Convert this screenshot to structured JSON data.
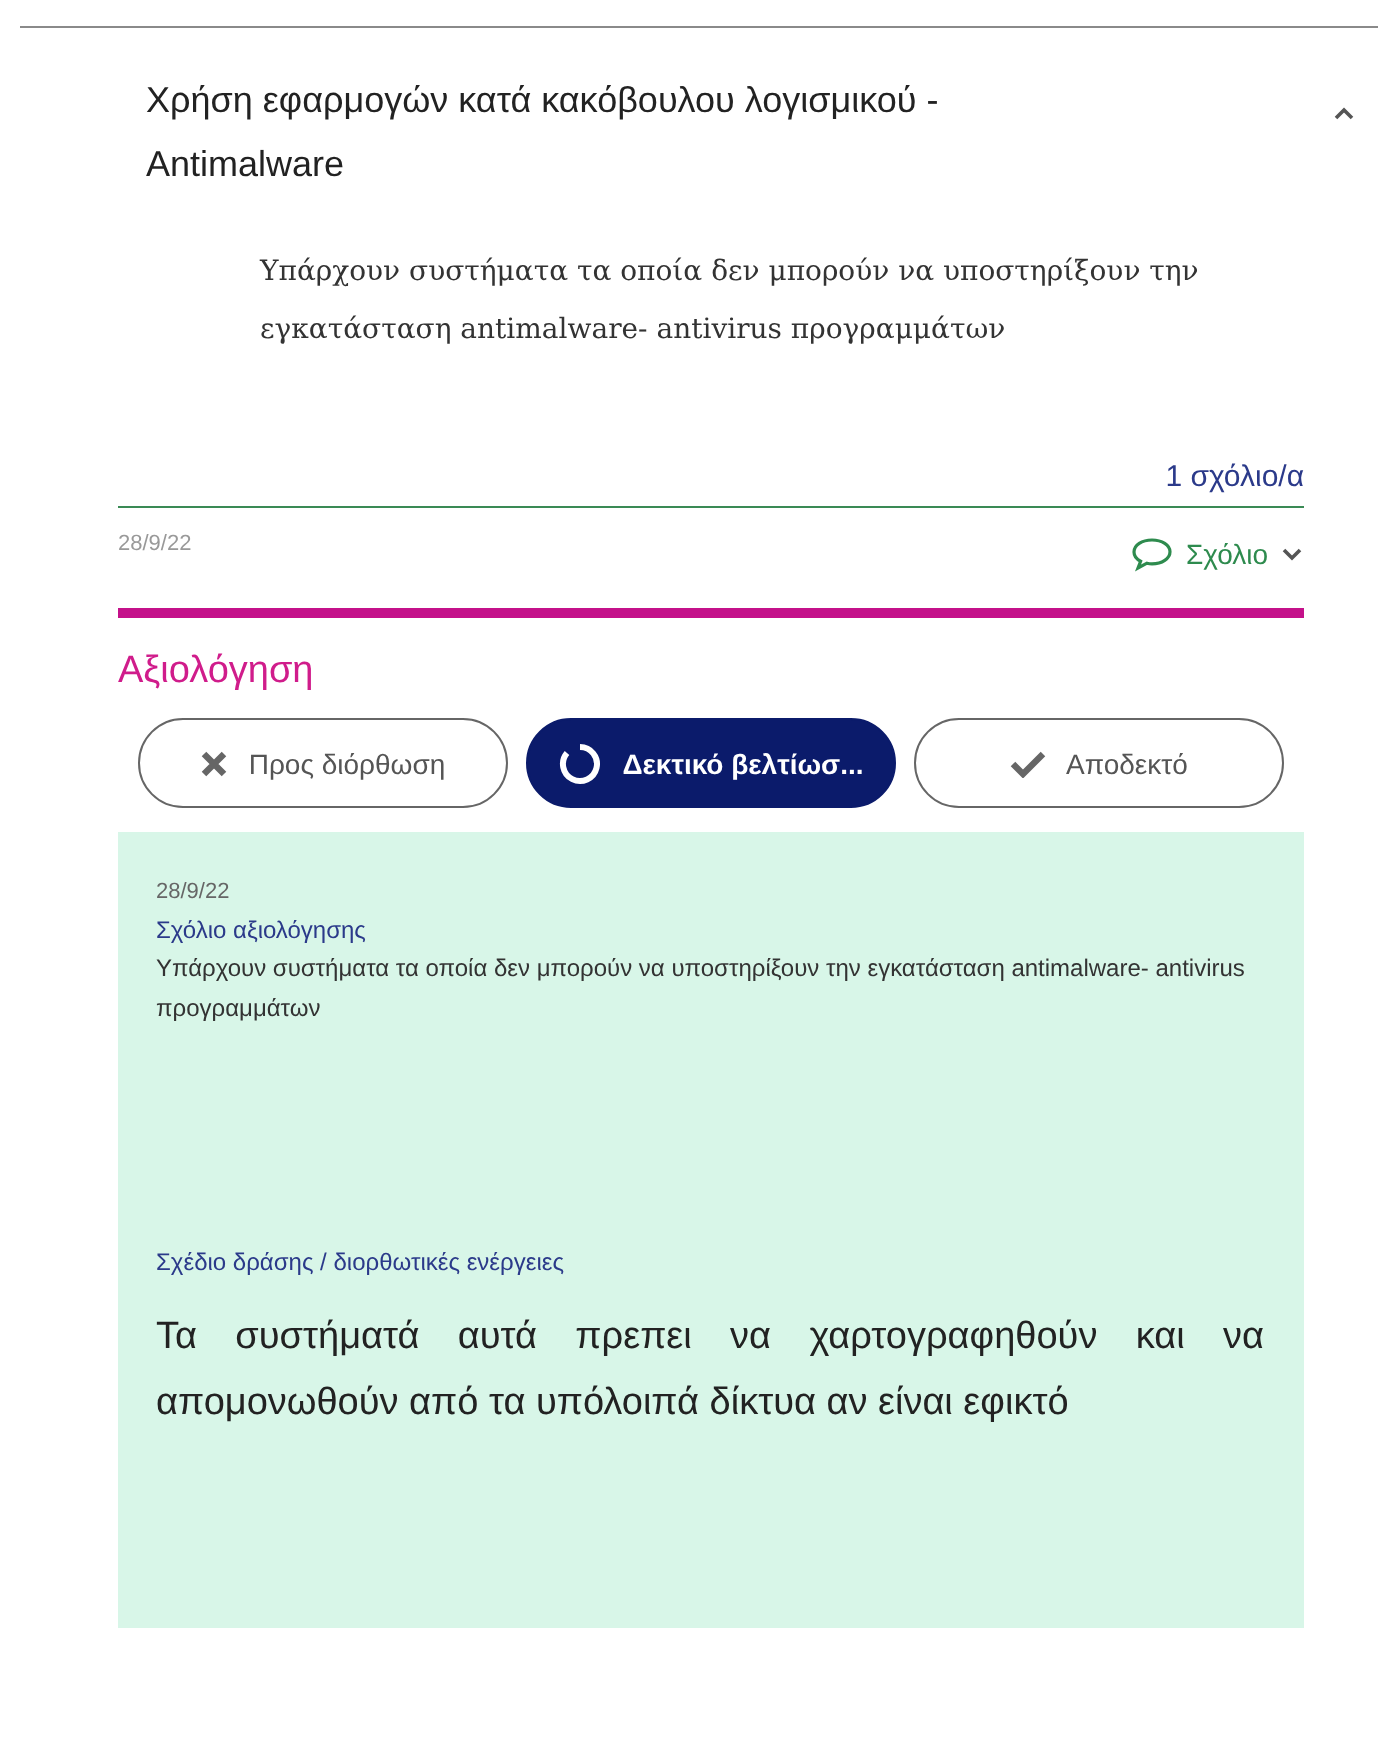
{
  "item": {
    "title": "Χρήση εφαρμογών κατά κακόβουλου λογισμικού - Antimalware",
    "expanded": true,
    "description": "Υπάρχουν συστήματα τα οποία δεν μπορούν να υποστηρίξουν την εγκατάσταση antimalware- antivirus προγραμμάτων",
    "comment_count": "1 σχόλιο/α",
    "date": "28/9/22",
    "comment_button": "Σχόλιο"
  },
  "evaluation": {
    "title": "Αξιολόγηση",
    "options": [
      {
        "kind": "cross",
        "label": "Προς διόρθωση",
        "selected": false
      },
      {
        "kind": "partial",
        "label": "Δεκτικό βελτίωσ...",
        "selected": true
      },
      {
        "kind": "check",
        "label": "Αποδεκτό",
        "selected": false
      }
    ],
    "date": "28/9/22",
    "comment_label": "Σχόλιο αξιολόγησης",
    "comment": "Υπάρχουν συστήματα τα οποία δεν μπορούν να υποστηρίξουν την εγκατάσταση antimalware- antivirus προγραμμάτων",
    "action_label": "Σχέδιο δράσης / διορθωτικές ενέργειες",
    "action": "Τα συστήματά αυτά πρεπει να χαρτογραφηθούν και να απομονωθούν από τα υπόλοιπά δίκτυα αν είναι εφικτό"
  }
}
